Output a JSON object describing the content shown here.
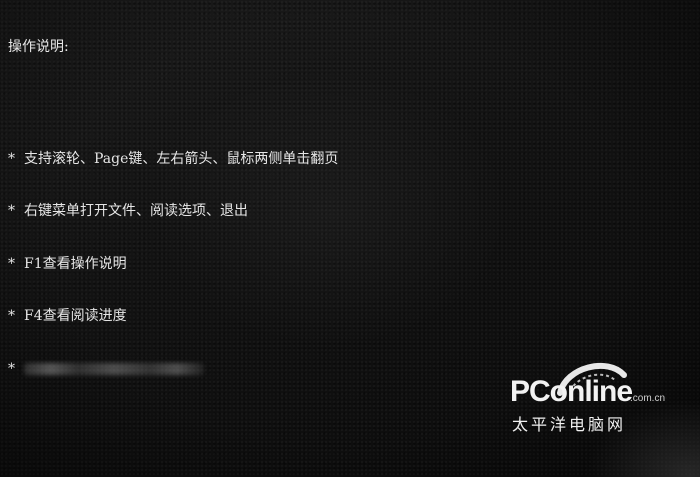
{
  "help": {
    "title": "操作说明:",
    "bullet": "*",
    "lines": [
      "支持滚轮、Page键、左右箭头、鼠标两侧单击翻页",
      "右键菜单打开文件、阅读选项、退出",
      "F1查看操作说明",
      "F4查看阅读进度"
    ]
  },
  "watermark": {
    "brand": "PConline",
    "domain": ".com.cn",
    "chinese": "太平洋电脑网"
  },
  "colors": {
    "text": "#e6e6e6",
    "background": "#151515"
  }
}
